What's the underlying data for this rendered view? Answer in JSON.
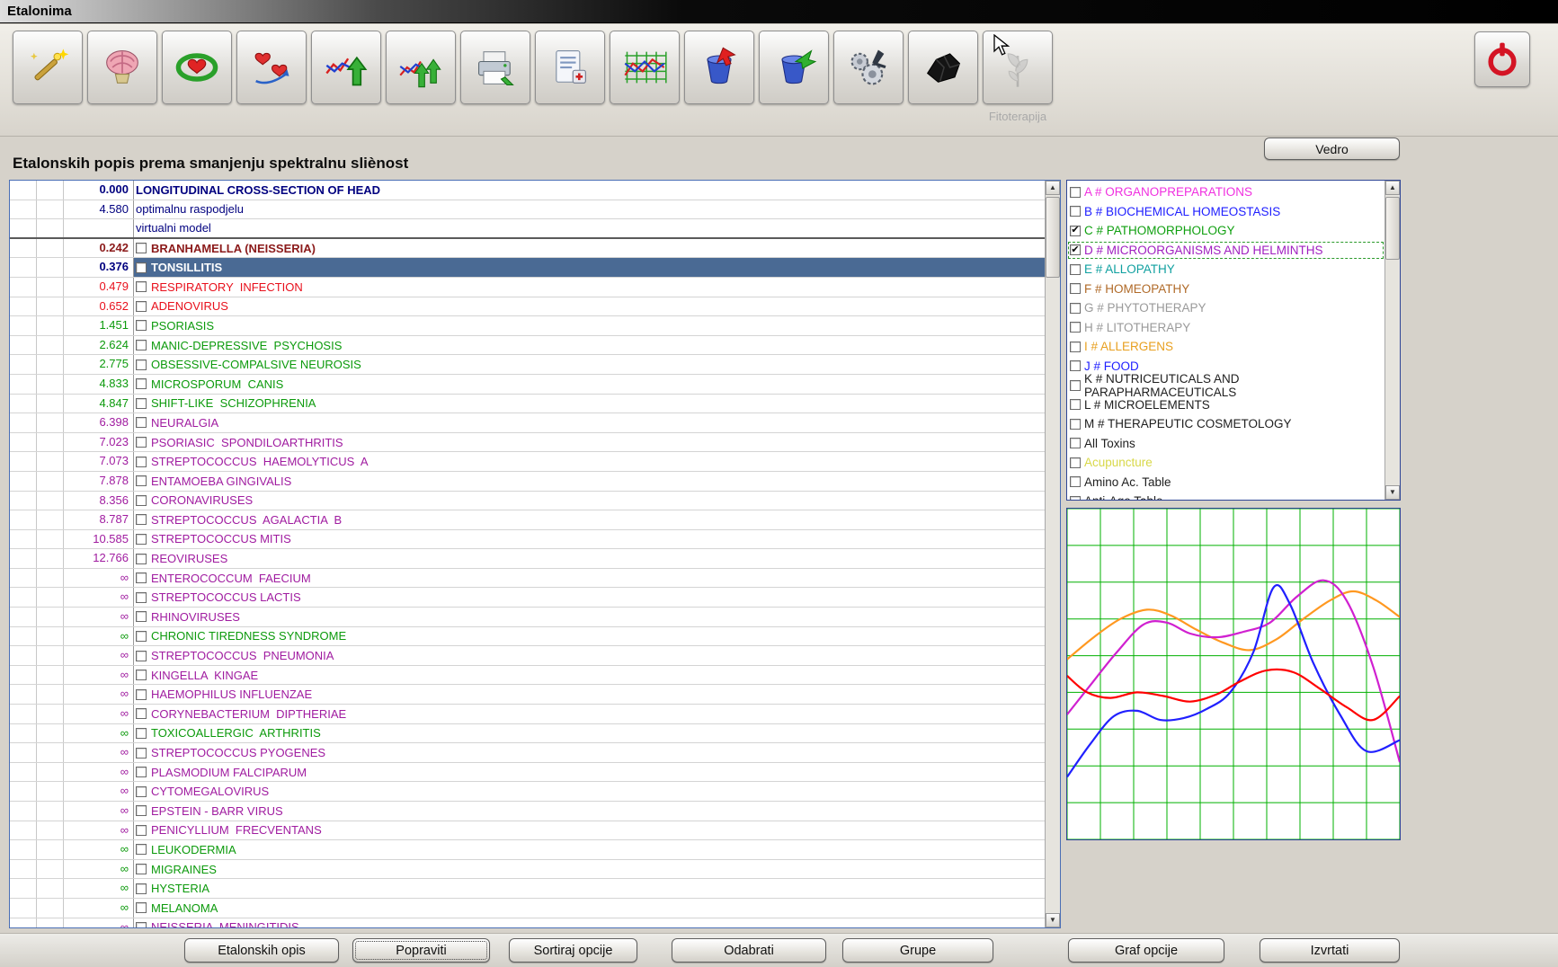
{
  "window": {
    "title": "Etalonima"
  },
  "toolbar": {
    "buttons": [
      {
        "icon": "wand-icon",
        "name": "wand"
      },
      {
        "icon": "brain-icon",
        "name": "brain"
      },
      {
        "icon": "etalon-ring-icon",
        "name": "etalon-ring"
      },
      {
        "icon": "hearts-icon",
        "name": "hearts"
      },
      {
        "icon": "chart-arrow-icon",
        "name": "chart-arrow"
      },
      {
        "icon": "chart-double-arrow-icon",
        "name": "chart-double-arrow"
      },
      {
        "icon": "printer-icon",
        "name": "print"
      },
      {
        "icon": "notes-icon",
        "name": "notes"
      },
      {
        "icon": "grid-chart-icon",
        "name": "grid-chart"
      },
      {
        "icon": "vessel-red-icon",
        "name": "vessel-red"
      },
      {
        "icon": "vessel-green-icon",
        "name": "vessel-green"
      },
      {
        "icon": "gears-icon",
        "name": "analysis"
      },
      {
        "icon": "coal-icon",
        "name": "coal"
      },
      {
        "icon": "plant-icon",
        "name": "fitoterapija",
        "disabled": true
      }
    ],
    "disabled_caption": "Fitoterapija",
    "power_button": {
      "icon": "power-icon",
      "name": "power"
    }
  },
  "header": {
    "list_title": "Etalonskih popis prema smanjenju spektralnu sliènost",
    "vedro_label": "Vedro"
  },
  "colors": {
    "navy": "#00007f",
    "maroon": "#8b1a1a",
    "red": "#e8101c",
    "green": "#0c9a0c",
    "purple": "#a01ca0",
    "selected_bg": "#4a6a94",
    "selected_fg": "#ffffff"
  },
  "etalon_table": {
    "rows": [
      {
        "value": "0.000",
        "name": "LONGITUDINAL CROSS-SECTION OF HEAD",
        "color": "navy",
        "bold": true,
        "checkbox": false
      },
      {
        "value": "4.580",
        "name": "optimalnu raspodjelu",
        "color": "navy",
        "checkbox": false
      },
      {
        "value": "",
        "name": "virtualni model",
        "color": "navy",
        "checkbox": false,
        "section_end": true
      },
      {
        "value": "0.242",
        "name": "BRANHAMELLA (NEISSERIA)",
        "color": "maroon",
        "bold": true,
        "checkbox": true
      },
      {
        "value": "0.376",
        "name": "TONSILLITIS",
        "color": "navy",
        "bold": true,
        "checkbox": true,
        "selected": true
      },
      {
        "value": "0.479",
        "name": "RESPIRATORY  INFECTION",
        "color": "red",
        "checkbox": true
      },
      {
        "value": "0.652",
        "name": "ADENOVIRUS",
        "color": "red",
        "checkbox": true
      },
      {
        "value": "1.451",
        "name": "PSORIASIS",
        "color": "green",
        "checkbox": true
      },
      {
        "value": "2.624",
        "name": "MANIC-DEPRESSIVE  PSYCHOSIS",
        "color": "green",
        "checkbox": true
      },
      {
        "value": "2.775",
        "name": "OBSESSIVE-COMPALSIVE NEUROSIS",
        "color": "green",
        "checkbox": true
      },
      {
        "value": "4.833",
        "name": "MICROSPORUM  CANIS",
        "color": "green",
        "checkbox": true
      },
      {
        "value": "4.847",
        "name": "SHIFT-LIKE  SCHIZOPHRENIA",
        "color": "green",
        "checkbox": true
      },
      {
        "value": "6.398",
        "name": "NEURALGIA",
        "color": "purple",
        "checkbox": true
      },
      {
        "value": "7.023",
        "name": "PSORIASIC  SPONDILOARTHRITIS",
        "color": "purple",
        "checkbox": true
      },
      {
        "value": "7.073",
        "name": "STREPTOCOCCUS  HAEMOLYTICUS  A",
        "color": "purple",
        "checkbox": true
      },
      {
        "value": "7.878",
        "name": "ENTAMOEBA GINGIVALIS",
        "color": "purple",
        "checkbox": true
      },
      {
        "value": "8.356",
        "name": "CORONAVIRUSES",
        "color": "purple",
        "checkbox": true
      },
      {
        "value": "8.787",
        "name": "STREPTOCOCCUS  AGALACTIA  B",
        "color": "purple",
        "checkbox": true
      },
      {
        "value": "10.585",
        "name": "STREPTOCOCCUS MITIS",
        "color": "purple",
        "checkbox": true
      },
      {
        "value": "12.766",
        "name": "REOVIRUSES",
        "color": "purple",
        "checkbox": true
      },
      {
        "value": "∞",
        "name": "ENTEROCOCCUM  FAECIUM",
        "color": "purple",
        "checkbox": true
      },
      {
        "value": "∞",
        "name": "STREPTOCOCCUS LACTIS",
        "color": "purple",
        "checkbox": true
      },
      {
        "value": "∞",
        "name": "RHINOVIRUSES",
        "color": "purple",
        "checkbox": true
      },
      {
        "value": "∞",
        "name": "CHRONIC TIREDNESS SYNDROME",
        "color": "green",
        "checkbox": true
      },
      {
        "value": "∞",
        "name": "STREPTOCOCCUS  PNEUMONIA",
        "color": "purple",
        "checkbox": true
      },
      {
        "value": "∞",
        "name": "KINGELLA  KINGAE",
        "color": "purple",
        "checkbox": true
      },
      {
        "value": "∞",
        "name": "HAEMOPHILUS INFLUENZAE",
        "color": "purple",
        "checkbox": true
      },
      {
        "value": "∞",
        "name": "CORYNEBACTERIUM  DIPTHERIAE",
        "color": "purple",
        "checkbox": true
      },
      {
        "value": "∞",
        "name": "TOXICOALLERGIC  ARTHRITIS",
        "color": "green",
        "checkbox": true
      },
      {
        "value": "∞",
        "name": "STREPTOCOCCUS PYOGENES",
        "color": "purple",
        "checkbox": true
      },
      {
        "value": "∞",
        "name": "PLASMODIUM FALCIPARUM",
        "color": "purple",
        "checkbox": true
      },
      {
        "value": "∞",
        "name": "CYTOMEGALOVIRUS",
        "color": "purple",
        "checkbox": true
      },
      {
        "value": "∞",
        "name": "EPSTEIN - BARR VIRUS",
        "color": "purple",
        "checkbox": true
      },
      {
        "value": "∞",
        "name": "PENICYLLIUM  FRECVENTANS",
        "color": "purple",
        "checkbox": true
      },
      {
        "value": "∞",
        "name": "LEUKODERMIA",
        "color": "green",
        "checkbox": true
      },
      {
        "value": "∞",
        "name": "MIGRAINES",
        "color": "green",
        "checkbox": true
      },
      {
        "value": "∞",
        "name": "HYSTERIA",
        "color": "green",
        "checkbox": true
      },
      {
        "value": "∞",
        "name": "MELANOMA",
        "color": "green",
        "checkbox": true
      },
      {
        "value": "∞",
        "name": "NEISSERIA  MENINGITIDIS",
        "color": "purple",
        "checkbox": true
      }
    ]
  },
  "categories": {
    "items": [
      {
        "label": "A # ORGANOPREPARATIONS",
        "color": "#f030e0",
        "checked": false
      },
      {
        "label": "B # BIOCHEMICAL HOMEOSTASIS",
        "color": "#2020ff",
        "checked": false
      },
      {
        "label": "C # PATHOMORPHOLOGY",
        "color": "#10a010",
        "checked": true
      },
      {
        "label": "D # MICROORGANISMS AND HELMINTHS",
        "color": "#a020c0",
        "checked": true,
        "focused": true
      },
      {
        "label": "E # ALLOPATHY",
        "color": "#10a0a0",
        "checked": false
      },
      {
        "label": "F # HOMEOPATHY",
        "color": "#b06a28",
        "checked": false
      },
      {
        "label": "G # PHYTOTHERAPY",
        "color": "#9a9a9a",
        "checked": false
      },
      {
        "label": "H # LITOTHERAPY",
        "color": "#9a9a9a",
        "checked": false
      },
      {
        "label": "I # ALLERGENS",
        "color": "#e8a020",
        "checked": false
      },
      {
        "label": "J # FOOD",
        "color": "#2020ff",
        "checked": false
      },
      {
        "label": "K # NUTRICEUTICALS AND PARAPHARMACEUTICALS",
        "color": "#202020",
        "checked": false
      },
      {
        "label": "L # MICROELEMENTS",
        "color": "#202020",
        "checked": false
      },
      {
        "label": "M # THERAPEUTIC COSMETOLOGY",
        "color": "#202020",
        "checked": false
      },
      {
        "label": "All Toxins",
        "color": "#202020",
        "checked": false
      },
      {
        "label": "Acupuncture",
        "color": "#d8d848",
        "checked": false
      },
      {
        "label": "Amino Ac. Table",
        "color": "#202020",
        "checked": false
      },
      {
        "label": "Anti-Age Table",
        "color": "#202020",
        "checked": false
      }
    ]
  },
  "chart_data": {
    "type": "line",
    "title": "",
    "x_divisions": 10,
    "y_divisions": 9,
    "grid_color": "#00b000",
    "legend": "none",
    "series": [
      {
        "name": "orange",
        "color": "#ff9820",
        "points": [
          [
            0,
            4.1
          ],
          [
            0.8,
            3.5
          ],
          [
            1.6,
            3.0
          ],
          [
            2.4,
            2.75
          ],
          [
            3.1,
            2.9
          ],
          [
            3.9,
            3.3
          ],
          [
            4.7,
            3.65
          ],
          [
            5.5,
            3.85
          ],
          [
            6.3,
            3.55
          ],
          [
            7.1,
            3.0
          ],
          [
            7.9,
            2.5
          ],
          [
            8.6,
            2.25
          ],
          [
            9.3,
            2.5
          ],
          [
            10,
            2.95
          ]
        ]
      },
      {
        "name": "magenta",
        "color": "#d020d0",
        "points": [
          [
            0,
            5.6
          ],
          [
            0.7,
            4.8
          ],
          [
            1.5,
            3.9
          ],
          [
            2.3,
            3.15
          ],
          [
            3.0,
            3.1
          ],
          [
            3.7,
            3.4
          ],
          [
            4.5,
            3.5
          ],
          [
            5.3,
            3.35
          ],
          [
            6.1,
            3.1
          ],
          [
            6.9,
            2.4
          ],
          [
            7.7,
            1.95
          ],
          [
            8.4,
            2.5
          ],
          [
            9.2,
            4.3
          ],
          [
            10,
            6.9
          ]
        ]
      },
      {
        "name": "blue",
        "color": "#2020ff",
        "points": [
          [
            0,
            7.3
          ],
          [
            0.7,
            6.4
          ],
          [
            1.4,
            5.65
          ],
          [
            2.1,
            5.5
          ],
          [
            2.8,
            5.75
          ],
          [
            3.5,
            5.7
          ],
          [
            4.2,
            5.45
          ],
          [
            4.9,
            5.0
          ],
          [
            5.6,
            3.9
          ],
          [
            6.2,
            2.15
          ],
          [
            6.7,
            2.6
          ],
          [
            7.4,
            4.2
          ],
          [
            8.2,
            5.6
          ],
          [
            9.0,
            6.6
          ],
          [
            10,
            6.3
          ]
        ]
      },
      {
        "name": "red",
        "color": "#ff0000",
        "points": [
          [
            0,
            4.55
          ],
          [
            0.6,
            5.0
          ],
          [
            1.3,
            5.15
          ],
          [
            2.1,
            5.0
          ],
          [
            2.9,
            5.1
          ],
          [
            3.7,
            5.25
          ],
          [
            4.5,
            5.05
          ],
          [
            5.2,
            4.7
          ],
          [
            6.0,
            4.4
          ],
          [
            6.8,
            4.45
          ],
          [
            7.6,
            4.9
          ],
          [
            8.4,
            5.4
          ],
          [
            9.2,
            5.75
          ],
          [
            10,
            5.1
          ]
        ]
      }
    ]
  },
  "footer": {
    "left_buttons": [
      "Etalonskih opis",
      "Popraviti",
      "Sortiraj opcije",
      "Odabrati",
      "Grupe"
    ],
    "focused_button": "Popraviti",
    "right_buttons": [
      "Graf opcije",
      "Izvrtati"
    ]
  }
}
